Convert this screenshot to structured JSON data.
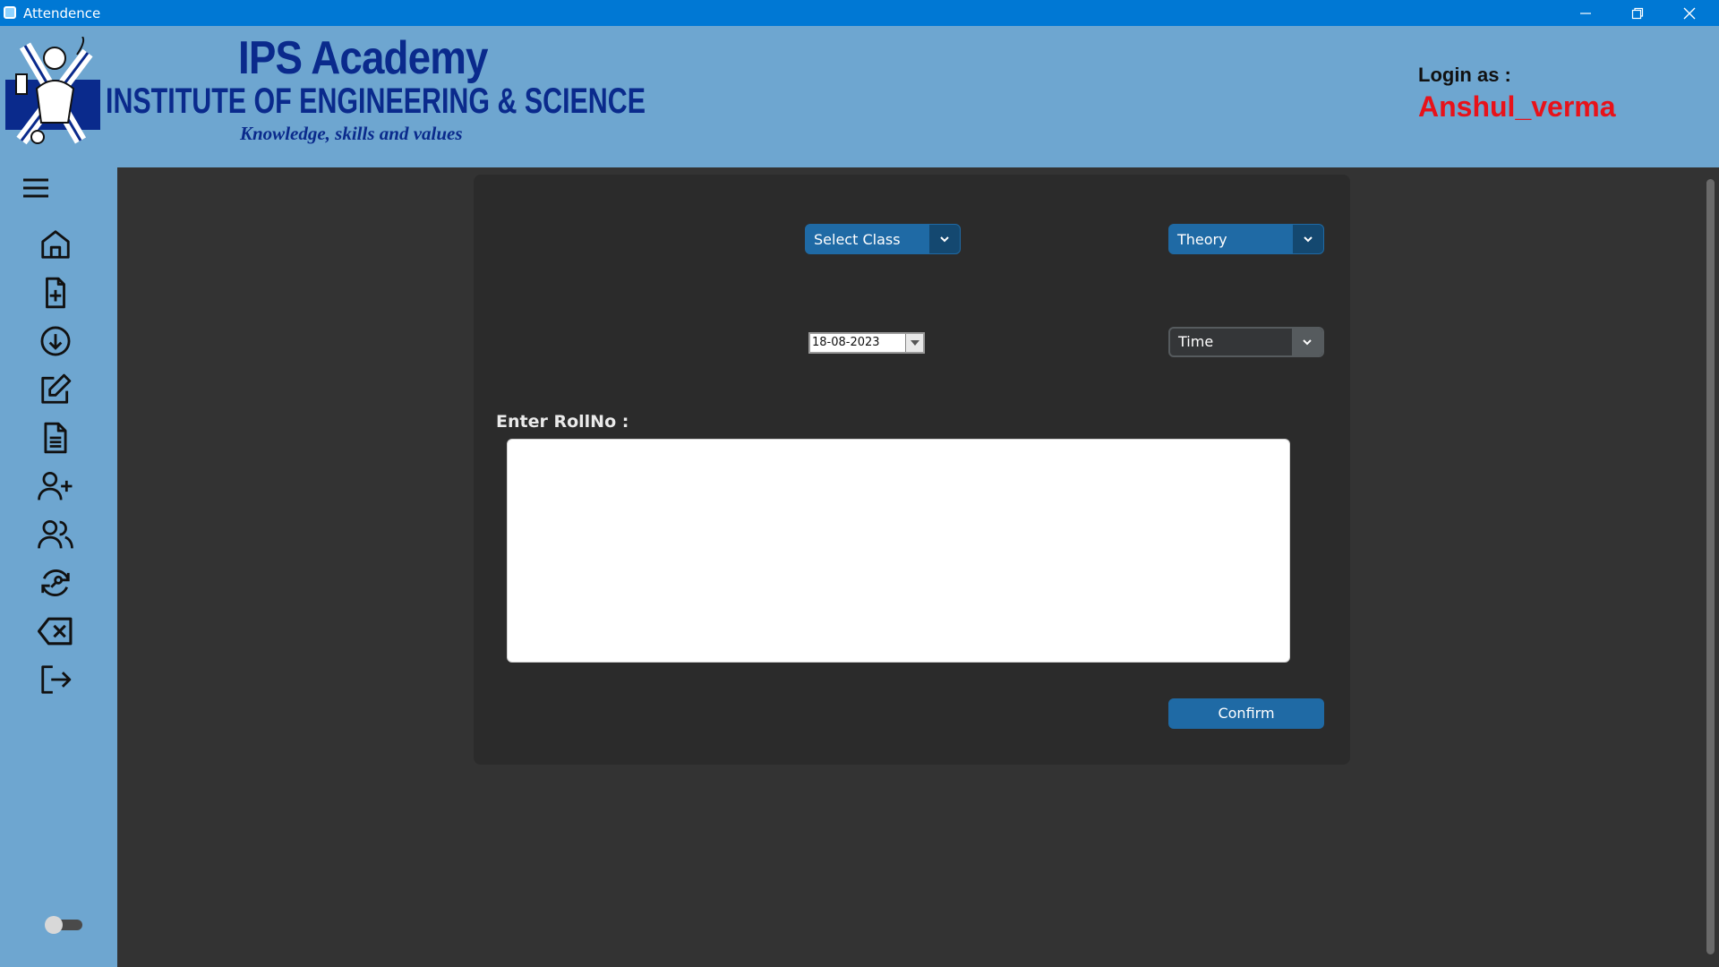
{
  "window": {
    "title": "Attendence",
    "icon": "app-icon",
    "controls": [
      "minimize-icon",
      "maximize-icon",
      "close-icon"
    ]
  },
  "header": {
    "logo_title": "IPS Academy",
    "logo_subtitle": "INSTITUTE OF ENGINEERING & SCIENCE",
    "logo_tagline": "Knowledge, skills and values",
    "login_label": "Login as :",
    "login_user": "Anshul_verma",
    "login_user_color": "#e8121a",
    "background_color": "#6ea6d0"
  },
  "sidebar": {
    "icons": [
      "menu-icon",
      "home-icon",
      "file-add-icon",
      "download-icon",
      "edit-icon",
      "document-icon",
      "user-add-icon",
      "users-icon",
      "refresh-key-icon",
      "delete-icon",
      "logout-icon"
    ],
    "theme_toggle": "off"
  },
  "form": {
    "class_select": "Select Class",
    "type_select": "Theory",
    "date_value": "18-08-2023",
    "time_select": "Time",
    "roll_label": "Enter RollNo :",
    "roll_value": "",
    "confirm_label": "Confirm",
    "accent_color": "#1f6aa5"
  }
}
